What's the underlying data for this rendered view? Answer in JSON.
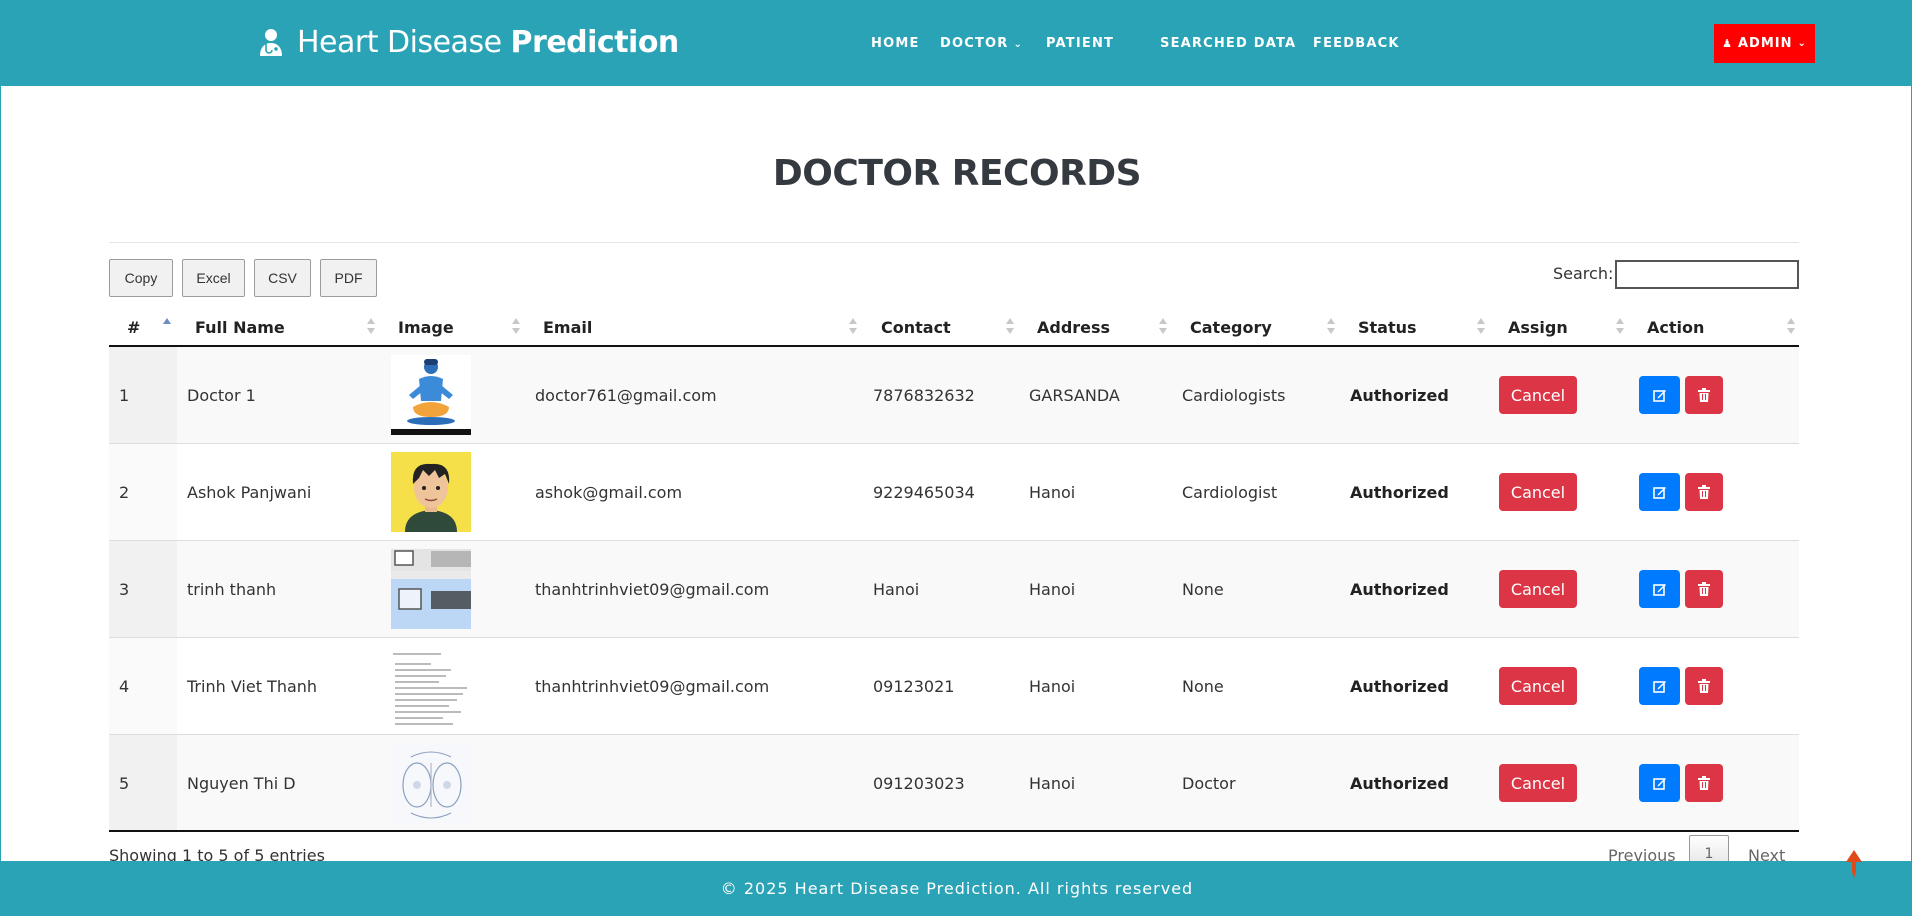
{
  "header": {
    "brand_light": "Heart Disease",
    "brand_bold": "Prediction",
    "nav": [
      {
        "label": "HOME"
      },
      {
        "label": "DOCTOR",
        "has_dropdown": true
      },
      {
        "label": "PATIENT"
      },
      {
        "label": "SEARCHED DATA"
      },
      {
        "label": "FEEDBACK"
      }
    ],
    "admin_label": "ADMIN"
  },
  "page": {
    "title": "DOCTOR RECORDS"
  },
  "toolbar": {
    "buttons": [
      "Copy",
      "Excel",
      "CSV",
      "PDF"
    ],
    "search_label": "Search:",
    "search_value": ""
  },
  "table": {
    "columns": [
      "#",
      "Full Name",
      "Image",
      "Email",
      "Contact",
      "Address",
      "Category",
      "Status",
      "Assign",
      "Action"
    ],
    "rows": [
      {
        "num": "1",
        "name": "Doctor 1",
        "image": "meditating-figure",
        "email": "doctor761@gmail.com",
        "contact": "7876832632",
        "address": "GARSANDA",
        "category": "Cardiologists",
        "status": "Authorized",
        "assign": "Cancel"
      },
      {
        "num": "2",
        "name": "Ashok Panjwani",
        "image": "cartoon-man",
        "email": "ashok@gmail.com",
        "contact": "9229465034",
        "address": "Hanoi",
        "category": "Cardiologist",
        "status": "Authorized",
        "assign": "Cancel"
      },
      {
        "num": "3",
        "name": "trinh thanh",
        "image": "folder-screenshot",
        "email": "thanhtrinhviet09@gmail.com",
        "contact": "Hanoi",
        "address": "Hanoi",
        "category": "None",
        "status": "Authorized",
        "assign": "Cancel"
      },
      {
        "num": "4",
        "name": "Trinh Viet Thanh",
        "image": "text-document",
        "email": "thanhtrinhviet09@gmail.com",
        "contact": "09123021",
        "address": "Hanoi",
        "category": "None",
        "status": "Authorized",
        "assign": "Cancel"
      },
      {
        "num": "5",
        "name": "Nguyen Thi D",
        "image": "diagram-sketch",
        "email": "",
        "contact": "091203023",
        "address": "Hanoi",
        "category": "Doctor",
        "status": "Authorized",
        "assign": "Cancel"
      }
    ]
  },
  "pagination": {
    "info": "Showing 1 to 5 of 5 entries",
    "previous": "Previous",
    "current": "1",
    "next": "Next"
  },
  "footer": {
    "text": "© 2025 Heart Disease Prediction. All rights reserved"
  },
  "colors": {
    "header_bg": "#2ba3b6",
    "admin_bg": "#ff0000",
    "cancel_bg": "#dc3545",
    "edit_bg": "#007bff"
  }
}
